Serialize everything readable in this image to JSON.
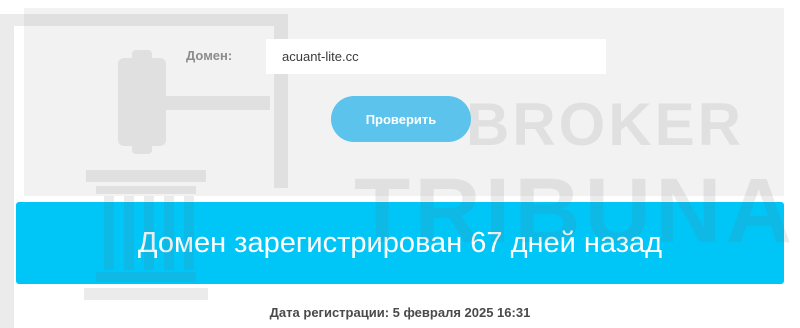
{
  "form": {
    "domain_label": "Домен:",
    "domain_value": "acuant-lite.cc",
    "check_button_label": "Проверить"
  },
  "result": {
    "message": "Домен зарегистрирован 67 дней назад"
  },
  "registration": {
    "date_text": "Дата регистрации: 5 февраля 2025 16:31"
  },
  "watermark": {
    "line1": "BROKER",
    "line2": "TRIBUNAL"
  },
  "colors": {
    "panel_bg": "#f2f2f3",
    "button_bg": "#5cc3ec",
    "banner_bg": "#00c6f8",
    "watermark": "#9a9a9a"
  },
  "icons": {
    "watermark_logo": "gavel-icon"
  }
}
